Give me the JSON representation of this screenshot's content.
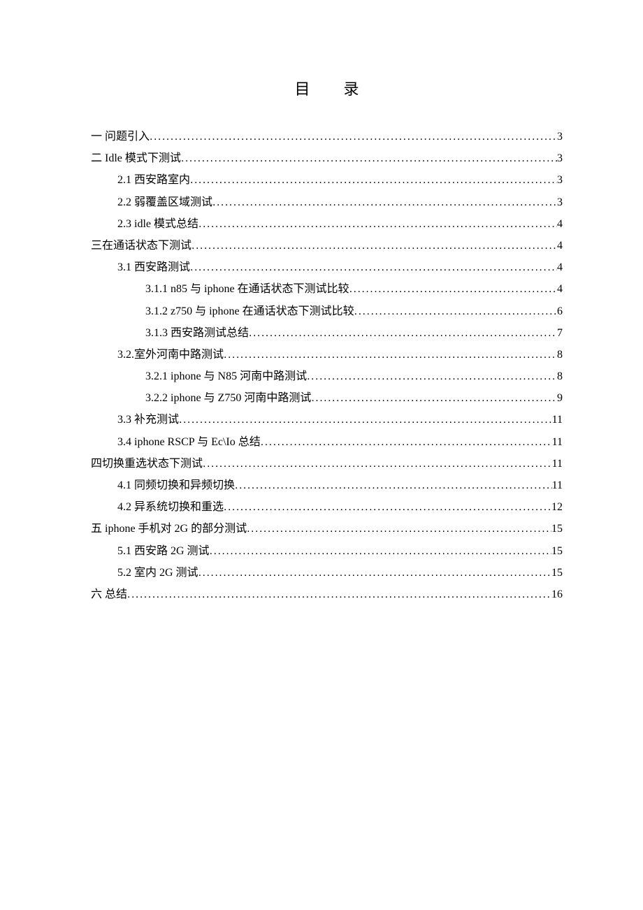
{
  "title": "目录",
  "entries": [
    {
      "level": 0,
      "text": "一  问题引入",
      "page": "3"
    },
    {
      "level": 0,
      "text": "二  Idle 模式下测试 ",
      "page": "3"
    },
    {
      "level": 1,
      "text": "2.1 西安路室内",
      "page": "3"
    },
    {
      "level": 1,
      "text": "2.2  弱覆盖区域测试",
      "page": "3"
    },
    {
      "level": 1,
      "text": "2.3 idle 模式总结",
      "page": "4"
    },
    {
      "level": 0,
      "text": "三在通话状态下测试",
      "page": "4"
    },
    {
      "level": 1,
      "text": "3.1 西安路测试",
      "page": "4"
    },
    {
      "level": 2,
      "text": "3.1.1 n85 与 iphone 在通话状态下测试比较",
      "page": "4"
    },
    {
      "level": 2,
      "text": "3.1.2 z750 与 iphone 在通话状态下测试比较",
      "page": "6"
    },
    {
      "level": 2,
      "text": "3.1.3 西安路测试总结",
      "page": "7"
    },
    {
      "level": 1,
      "text": "3.2.室外河南中路测试",
      "page": "8"
    },
    {
      "level": 2,
      "text": "3.2.1 iphone 与 N85 河南中路测试",
      "page": "8"
    },
    {
      "level": 2,
      "text": "3.2.2 iphone 与 Z750 河南中路测试 ",
      "page": "9"
    },
    {
      "level": 1,
      "text": "3.3 补充测试",
      "page": "11"
    },
    {
      "level": 1,
      "text": "3.4 iphone RSCP 与 Ec\\Io 总结 ",
      "page": "11"
    },
    {
      "level": 0,
      "text": "四切换重选状态下测试",
      "page": "11"
    },
    {
      "level": 1,
      "text": "4.1 同频切换和异频切换",
      "page": "11"
    },
    {
      "level": 1,
      "text": "4.2 异系统切换和重选",
      "page": "12"
    },
    {
      "level": 0,
      "text": "五 iphone 手机对 2G 的部分测试",
      "page": "15"
    },
    {
      "level": 1,
      "text": "5.1 西安路 2G 测试",
      "page": "15"
    },
    {
      "level": 1,
      "text": "5.2 室内 2G 测试",
      "page": "15"
    },
    {
      "level": 0,
      "text": "六  总结",
      "page": "16"
    }
  ]
}
